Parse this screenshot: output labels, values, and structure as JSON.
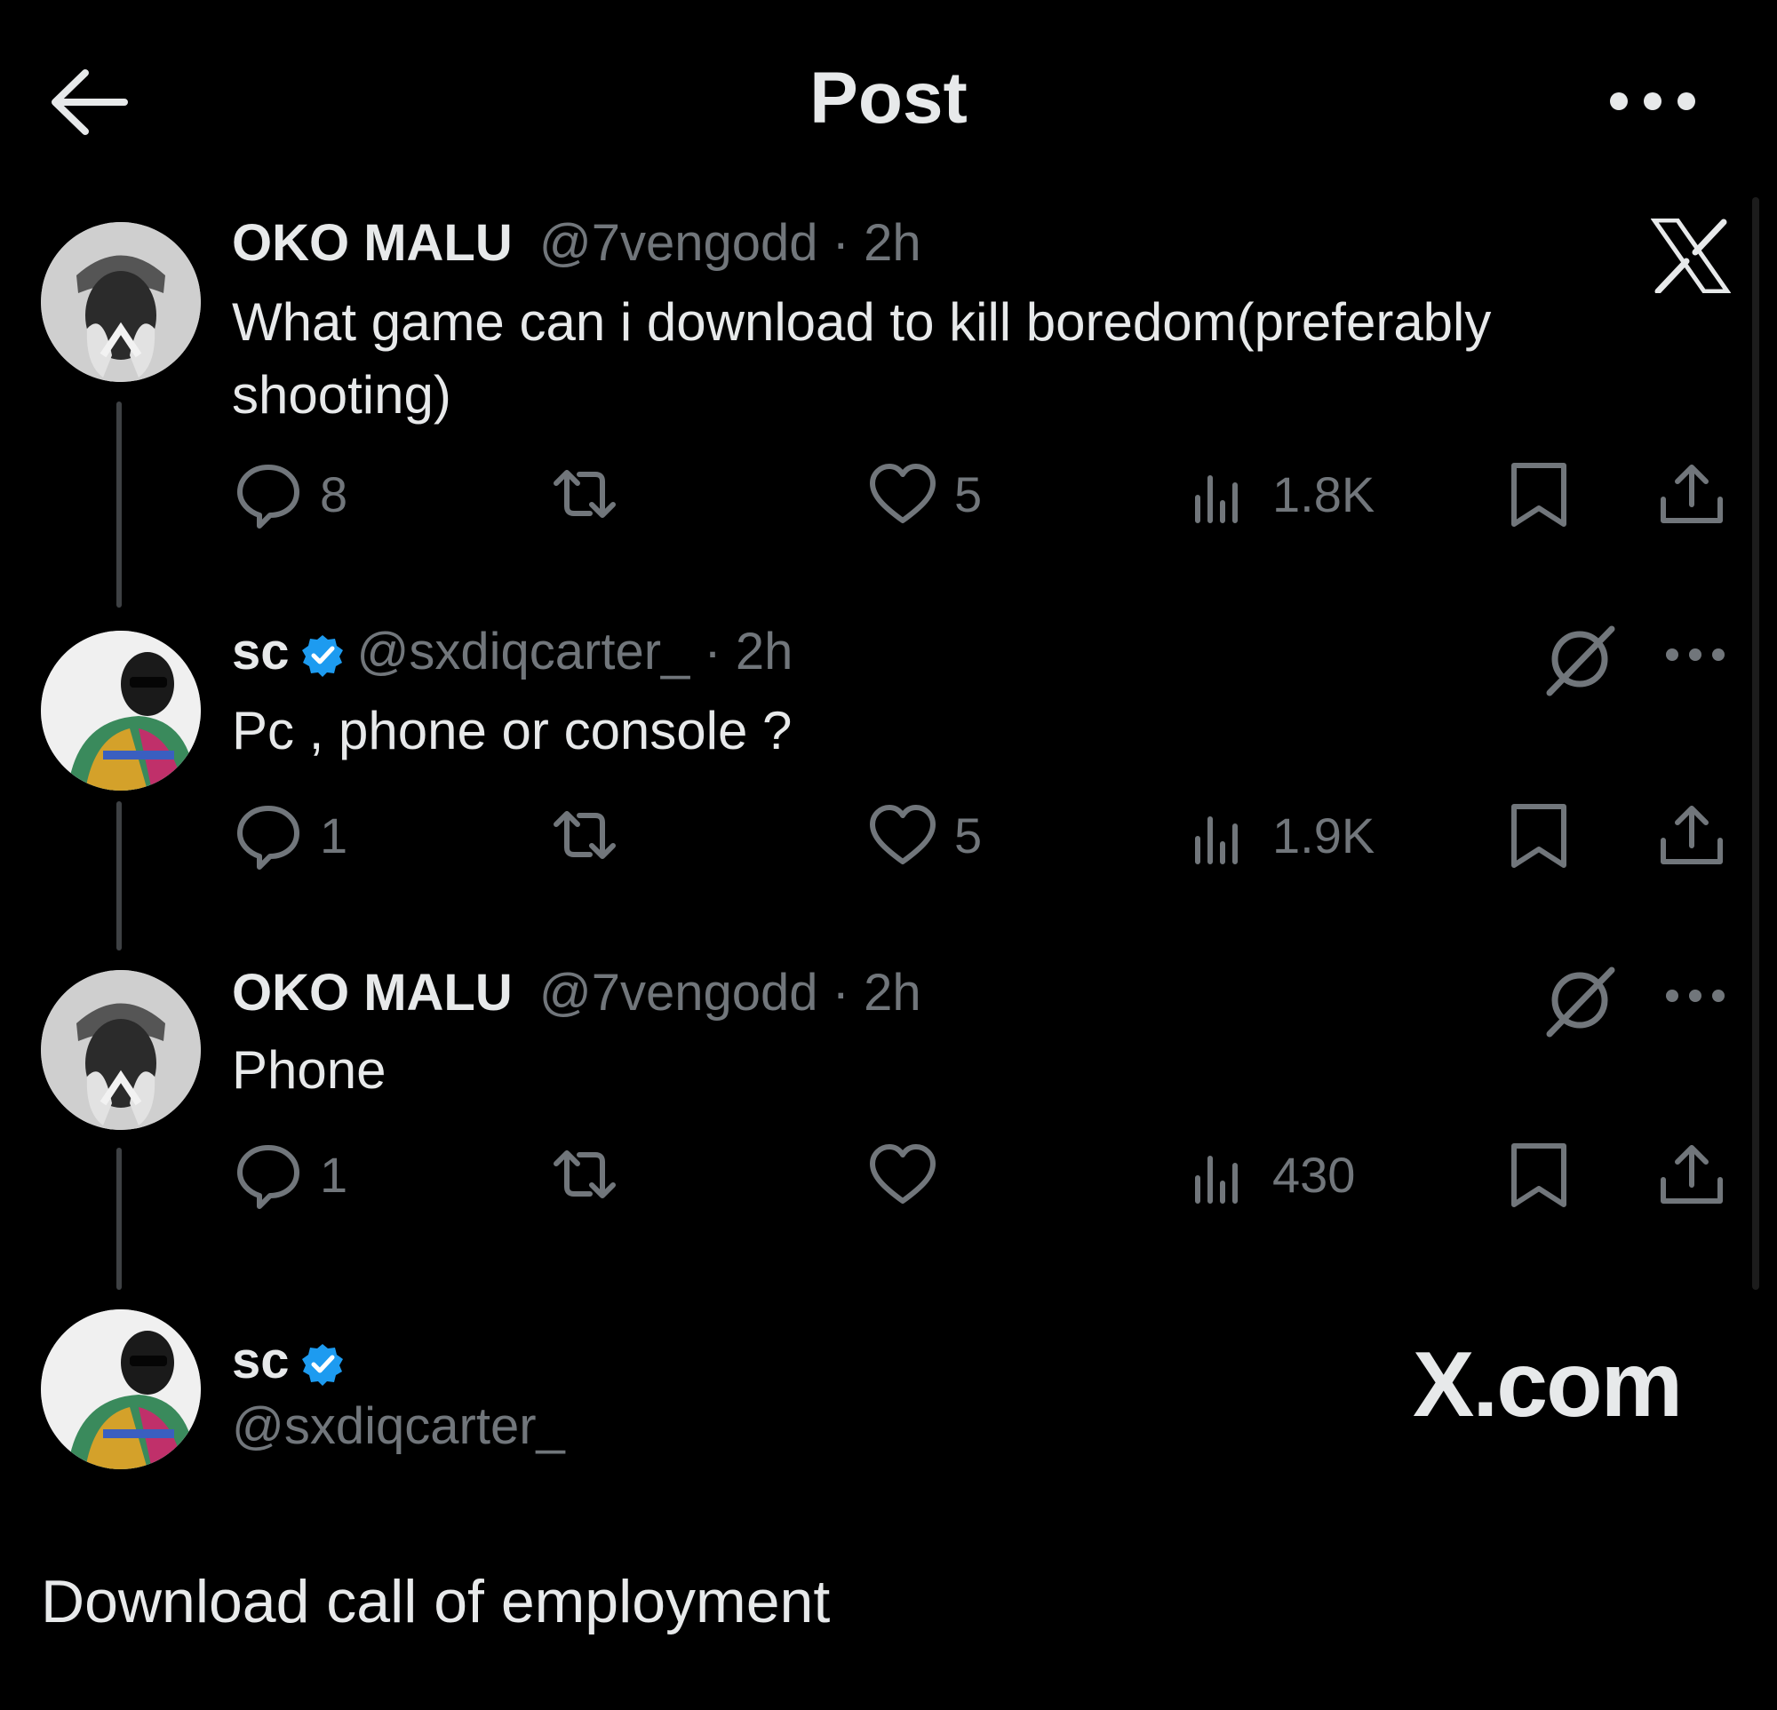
{
  "header": {
    "title": "Post",
    "back_icon": "arrow-left-icon",
    "more_icon": "more-horizontal-icon"
  },
  "watermark": {
    "logo": "x-logo-icon",
    "site": "X.com"
  },
  "colors": {
    "background": "#000000",
    "text": "#e7e9ea",
    "muted": "#71767b",
    "verified": "#1d9bf0",
    "thread_line": "#3e4144"
  },
  "posts": [
    {
      "name": "OKO MALU",
      "handle": "@7vengodd",
      "sep_time": " · 2h",
      "verified": false,
      "text": "What game can i download to kill boredom(preferably shooting)",
      "replies": "8",
      "reposts": "",
      "likes": "5",
      "views": "1.8K"
    },
    {
      "name": "sc",
      "handle": "@sxdiqcarter_",
      "sep_time": " · 2h",
      "verified": true,
      "text": "Pc , phone or console ?",
      "replies": "1",
      "reposts": "",
      "likes": "5",
      "views": "1.9K"
    },
    {
      "name": "OKO MALU",
      "handle": "@7vengodd",
      "sep_time": " · 2h",
      "verified": false,
      "text": "Phone",
      "replies": "1",
      "reposts": "",
      "likes": "",
      "views": "430"
    }
  ],
  "main_post": {
    "name": "sc",
    "handle": "@sxdiqcarter_",
    "verified": true,
    "text": "Download call of employment"
  }
}
